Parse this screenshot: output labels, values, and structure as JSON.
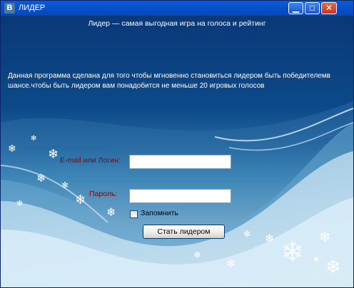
{
  "window": {
    "title": "ЛИДЕР",
    "logo": "В",
    "controls": {
      "minimize_icon": "minimize-icon",
      "maximize_icon": "maximize-icon",
      "close_icon": "close-icon"
    }
  },
  "main": {
    "heading": "Лидер — самая выгодная игра на голоса и рейтинг",
    "description": "Данная программа сделана для того чтобы мгновенно становиться лидером быть победителемв шансе.чтобы быть лидером вам понадобится не меньше 20 игровых голосов"
  },
  "form": {
    "login_label": "E-mail или Логин:",
    "login_value": "",
    "password_label": "Пароль:",
    "password_value": "",
    "remember_label": "Запомнить",
    "remember_checked": false,
    "submit_label": "Стать лидером"
  },
  "colors": {
    "background": "#0b3a78",
    "label_text": "#8b0000",
    "titlebar": "#0a5bd8"
  }
}
